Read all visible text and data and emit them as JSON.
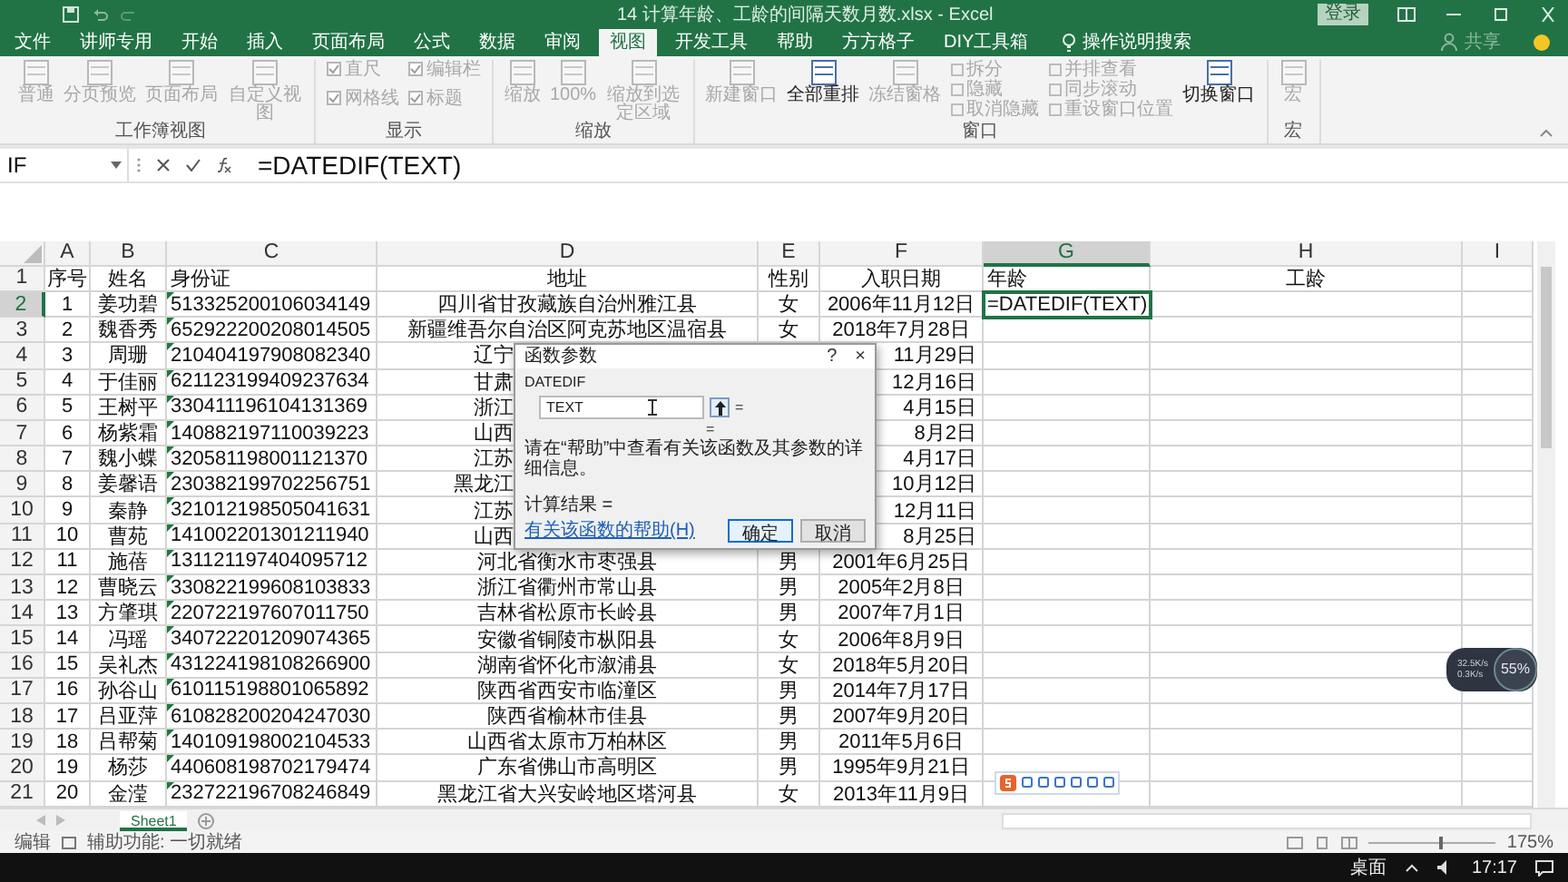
{
  "window": {
    "title": "14 计算年龄、工龄的间隔天数月数.xlsx  -  Excel",
    "login_button": "登录"
  },
  "ribbon": {
    "tabs": [
      {
        "label": "文件",
        "selected": false
      },
      {
        "label": "讲师专用",
        "selected": false
      },
      {
        "label": "开始",
        "selected": false
      },
      {
        "label": "插入",
        "selected": false
      },
      {
        "label": "页面布局",
        "selected": false
      },
      {
        "label": "公式",
        "selected": false
      },
      {
        "label": "数据",
        "selected": false
      },
      {
        "label": "审阅",
        "selected": false
      },
      {
        "label": "视图",
        "selected": true
      },
      {
        "label": "开发工具",
        "selected": false
      },
      {
        "label": "帮助",
        "selected": false
      },
      {
        "label": "方方格子",
        "selected": false
      },
      {
        "label": "DIY工具箱",
        "selected": false
      }
    ],
    "search_hint": "操作说明搜索",
    "share": "共享",
    "groups": [
      {
        "label": "工作簿视图",
        "commands": [
          {
            "label": "普通",
            "kind": "large",
            "disabled": true
          },
          {
            "label": "分页预览",
            "kind": "large",
            "disabled": true
          },
          {
            "label": "页面布局",
            "kind": "large",
            "disabled": true
          },
          {
            "label": "自定义视图",
            "kind": "large",
            "disabled": true
          }
        ]
      },
      {
        "label": "显示",
        "commands": [
          {
            "label": "直尺",
            "kind": "check",
            "checked": true,
            "disabled": true
          },
          {
            "label": "网格线",
            "kind": "check",
            "checked": true,
            "disabled": true
          },
          {
            "label": "编辑栏",
            "kind": "check",
            "checked": true,
            "disabled": true
          },
          {
            "label": "标题",
            "kind": "check",
            "checked": true,
            "disabled": true
          }
        ]
      },
      {
        "label": "缩放",
        "commands": [
          {
            "label": "缩放",
            "kind": "large",
            "disabled": true
          },
          {
            "label": "100%",
            "kind": "large",
            "disabled": true
          },
          {
            "label": "缩放到选定区域",
            "kind": "large",
            "disabled": true
          }
        ]
      },
      {
        "label": "窗口",
        "commands": [
          {
            "label": "新建窗口",
            "kind": "large",
            "disabled": true
          },
          {
            "label": "全部重排",
            "kind": "large",
            "disabled": false
          },
          {
            "label": "冻结窗格",
            "kind": "large",
            "disabled": true
          },
          {
            "label": "拆分",
            "kind": "small",
            "disabled": true
          },
          {
            "label": "隐藏",
            "kind": "small",
            "disabled": true
          },
          {
            "label": "取消隐藏",
            "kind": "small",
            "disabled": true
          },
          {
            "label": "并排查看",
            "kind": "small",
            "disabled": true
          },
          {
            "label": "同步滚动",
            "kind": "small",
            "disabled": true
          },
          {
            "label": "重设窗口位置",
            "kind": "small",
            "disabled": true
          },
          {
            "label": "切换窗口",
            "kind": "large",
            "disabled": false
          }
        ]
      },
      {
        "label": "宏",
        "commands": [
          {
            "label": "宏",
            "kind": "large",
            "disabled": true
          }
        ]
      }
    ]
  },
  "formula_bar": {
    "name_box": "IF",
    "formula": "=DATEDIF(TEXT)"
  },
  "sheet": {
    "columns": [
      {
        "label": "A",
        "selected": false
      },
      {
        "label": "B",
        "selected": false
      },
      {
        "label": "C",
        "selected": false
      },
      {
        "label": "D",
        "selected": false
      },
      {
        "label": "E",
        "selected": false
      },
      {
        "label": "F",
        "selected": false
      },
      {
        "label": "G",
        "selected": true
      },
      {
        "label": "H",
        "selected": false
      },
      {
        "label": "I",
        "selected": false
      }
    ],
    "rows": [
      {
        "number": "1",
        "selected": false,
        "no": "序号",
        "name": "姓名",
        "id": "身份证",
        "address": "地址",
        "gender": "性别",
        "hire_date": "入职日期",
        "age": "年龄",
        "seniority": "工龄"
      },
      {
        "number": "2",
        "selected": true,
        "no": "1",
        "name": "姜功碧",
        "id": "513325200106034149",
        "number_as_text": true,
        "address": "四川省甘孜藏族自治州雅江县",
        "gender": "女",
        "hire_date": "2006年11月12日",
        "age": "=DATEDIF(TEXT)"
      },
      {
        "number": "3",
        "selected": false,
        "no": "2",
        "name": "魏香秀",
        "id": "652922200208014505",
        "number_as_text": true,
        "address": "新疆维吾尔自治区阿克苏地区温宿县",
        "gender": "女",
        "hire_date": "2018年7月28日"
      },
      {
        "number": "4",
        "selected": false,
        "no": "3",
        "name": "周珊",
        "id": "210404197908082340",
        "number_as_text": true,
        "address": "辽宁",
        "hire_date": "11月29日",
        "partly_hidden": true
      },
      {
        "number": "5",
        "selected": false,
        "no": "4",
        "name": "于佳丽",
        "id": "621123199409237634",
        "number_as_text": true,
        "address": "甘肃",
        "hire_date": "12月16日",
        "partly_hidden": true
      },
      {
        "number": "6",
        "selected": false,
        "no": "5",
        "name": "王树平",
        "id": "330411196104131369",
        "number_as_text": true,
        "address": "浙江",
        "hire_date": "4月15日",
        "partly_hidden": true
      },
      {
        "number": "7",
        "selected": false,
        "no": "6",
        "name": "杨紫霜",
        "id": "140882197110039223",
        "number_as_text": true,
        "address": "山西",
        "hire_date": "8月2日",
        "partly_hidden": true
      },
      {
        "number": "8",
        "selected": false,
        "no": "7",
        "name": "魏小蝶",
        "id": "320581198001121370",
        "number_as_text": true,
        "address": "江苏",
        "hire_date": "4月17日",
        "partly_hidden": true
      },
      {
        "number": "9",
        "selected": false,
        "no": "8",
        "name": "姜馨语",
        "id": "230382199702256751",
        "number_as_text": true,
        "address": "黑龙江",
        "hire_date": "10月12日",
        "partly_hidden": true
      },
      {
        "number": "10",
        "selected": false,
        "no": "9",
        "name": "秦静",
        "id": "321012198505041631",
        "number_as_text": true,
        "address": "江苏",
        "hire_date": "12月11日",
        "partly_hidden": true
      },
      {
        "number": "11",
        "selected": false,
        "no": "10",
        "name": "曹苑",
        "id": "141002201301211940",
        "number_as_text": true,
        "address": "山西",
        "hire_date": "8月25日",
        "partly_hidden": true
      },
      {
        "number": "12",
        "selected": false,
        "no": "11",
        "name": "施蓓",
        "id": "131121197404095712",
        "number_as_text": true,
        "address": "河北省衡水市枣强县",
        "gender": "男",
        "hire_date": "2001年6月25日"
      },
      {
        "number": "13",
        "selected": false,
        "no": "12",
        "name": "曹晓云",
        "id": "330822199608103833",
        "number_as_text": true,
        "address": "浙江省衢州市常山县",
        "gender": "男",
        "hire_date": "2005年2月8日"
      },
      {
        "number": "14",
        "selected": false,
        "no": "13",
        "name": "方肇琪",
        "id": "220722197607011750",
        "number_as_text": true,
        "address": "吉林省松原市长岭县",
        "gender": "男",
        "hire_date": "2007年7月1日"
      },
      {
        "number": "15",
        "selected": false,
        "no": "14",
        "name": "冯瑶",
        "id": "340722201209074365",
        "number_as_text": true,
        "address": "安徽省铜陵市枞阳县",
        "gender": "女",
        "hire_date": "2006年8月9日"
      },
      {
        "number": "16",
        "selected": false,
        "no": "15",
        "name": "吴礼杰",
        "id": "431224198108266900",
        "number_as_text": true,
        "address": "湖南省怀化市溆浦县",
        "gender": "女",
        "hire_date": "2018年5月20日"
      },
      {
        "number": "17",
        "selected": false,
        "no": "16",
        "name": "孙谷山",
        "id": "610115198801065892",
        "number_as_text": true,
        "address": "陕西省西安市临潼区",
        "gender": "男",
        "hire_date": "2014年7月17日"
      },
      {
        "number": "18",
        "selected": false,
        "no": "17",
        "name": "吕亚萍",
        "id": "610828200204247030",
        "number_as_text": true,
        "address": "陕西省榆林市佳县",
        "gender": "男",
        "hire_date": "2007年9月20日"
      },
      {
        "number": "19",
        "selected": false,
        "no": "18",
        "name": "吕帮菊",
        "id": "140109198002104533",
        "number_as_text": true,
        "address": "山西省太原市万柏林区",
        "gender": "男",
        "hire_date": "2011年5月6日"
      },
      {
        "number": "20",
        "selected": false,
        "no": "19",
        "name": "杨莎",
        "id": "440608198702179474",
        "number_as_text": true,
        "address": "广东省佛山市高明区",
        "gender": "男",
        "hire_date": "1995年9月21日"
      },
      {
        "number": "21",
        "selected": false,
        "no": "20",
        "name": "金滢",
        "id": "232722196708246849",
        "number_as_text": true,
        "address": "黑龙江省大兴安岭地区塔河县",
        "gender": "女",
        "hire_date": "2013年11月9日"
      }
    ]
  },
  "dialog": {
    "title": "函数参数",
    "help_button": "?",
    "close_button": "×",
    "function_name": "DATEDIF",
    "argument_value": "TEXT",
    "argument_result": "=",
    "function_result": "=",
    "description": "请在“帮助”中查看有关该函数及其参数的详细信息。",
    "calc_result": "计算结果 =",
    "help_link": "有关该函数的帮助(H)",
    "buttons": [
      {
        "label": "确定",
        "default": true
      },
      {
        "label": "取消",
        "default": false
      }
    ]
  },
  "speed_widget": {
    "upload": "32.5K/s",
    "download": "0.3K/s",
    "percent": "55%"
  },
  "sheet_tabs": [
    {
      "label": "Sheet1",
      "selected": true
    }
  ],
  "status_bar": {
    "mode": "编辑",
    "accessibility": "辅助功能: 一切就绪",
    "zoom": "175%",
    "zoom_slider": {
      "level": 0.55
    }
  },
  "taskbar": {
    "desktop": "桌面",
    "time": "17:17"
  }
}
